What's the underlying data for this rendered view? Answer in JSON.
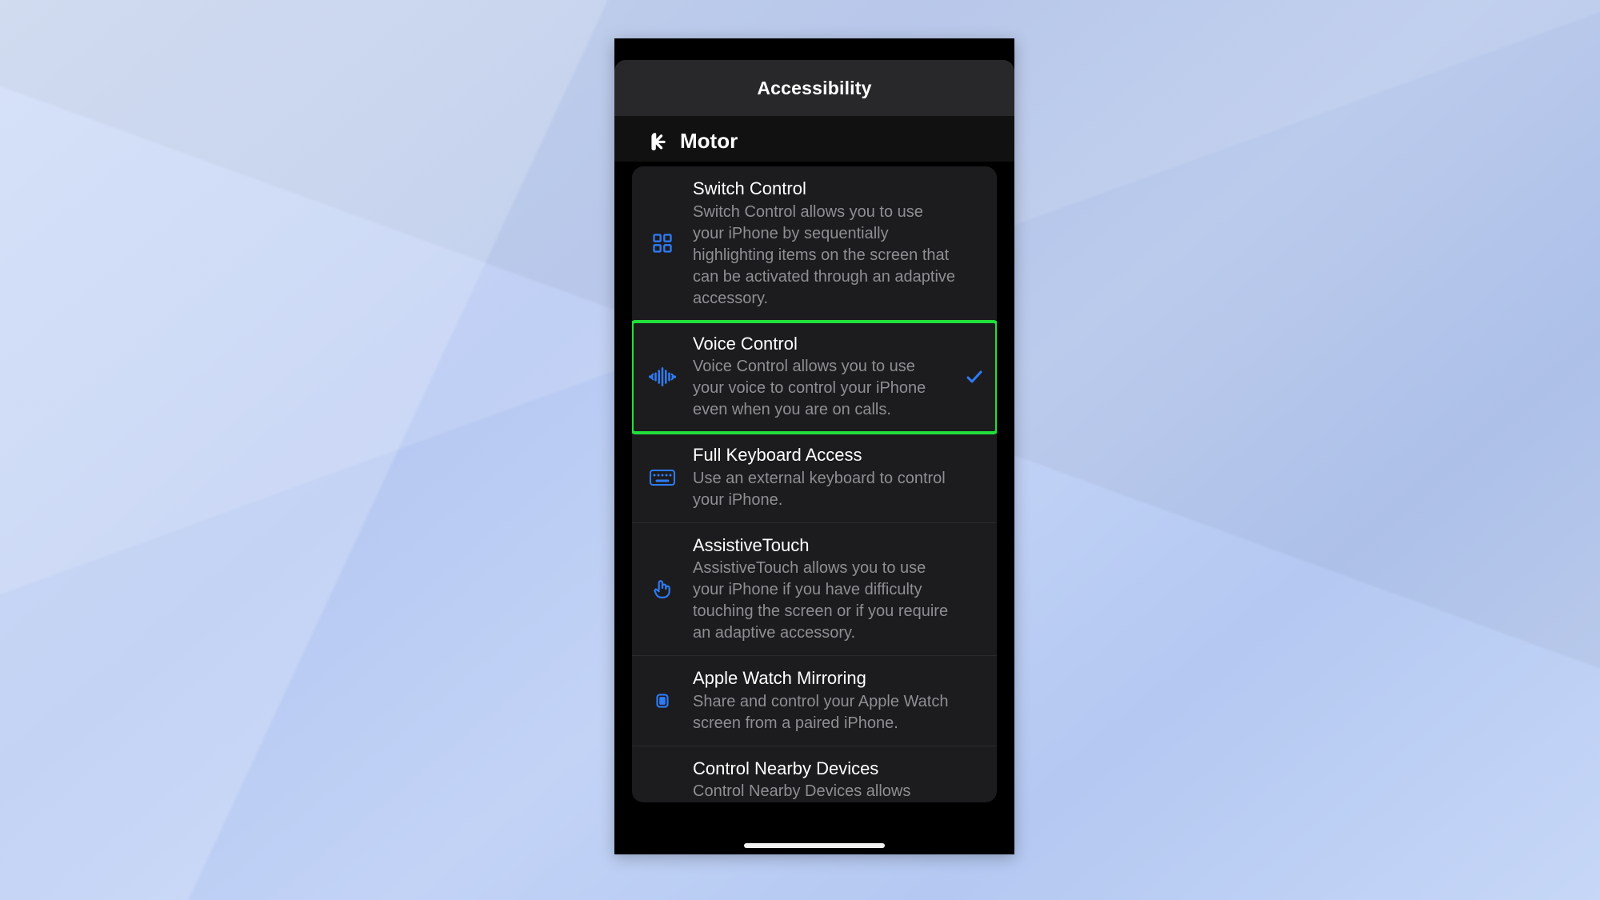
{
  "header": {
    "title": "Accessibility"
  },
  "section": {
    "title": "Motor"
  },
  "rows": [
    {
      "id": "switch-control",
      "title": "Switch Control",
      "desc": "Switch Control allows you to use your iPhone by sequentially highlighting items on the screen that can be activated through an adaptive accessory.",
      "checked": false,
      "highlighted": false
    },
    {
      "id": "voice-control",
      "title": "Voice Control",
      "desc": "Voice Control allows you to use your voice to control your iPhone even when you are on calls.",
      "checked": true,
      "highlighted": true
    },
    {
      "id": "full-keyboard-access",
      "title": "Full Keyboard Access",
      "desc": "Use an external keyboard to control your iPhone.",
      "checked": false,
      "highlighted": false
    },
    {
      "id": "assistivetouch",
      "title": "AssistiveTouch",
      "desc": "AssistiveTouch allows you to use your iPhone if you have difficulty touching the screen or if you require an adaptive accessory.",
      "checked": false,
      "highlighted": false
    },
    {
      "id": "apple-watch-mirroring",
      "title": "Apple Watch Mirroring",
      "desc": "Share and control your Apple Watch screen from a paired iPhone.",
      "checked": false,
      "highlighted": false
    },
    {
      "id": "control-nearby-devices",
      "title": "Control Nearby Devices",
      "desc": "Control Nearby Devices allows",
      "checked": false,
      "highlighted": false
    }
  ],
  "colors": {
    "accent": "#2f7bf6",
    "highlight": "#22e03a"
  }
}
